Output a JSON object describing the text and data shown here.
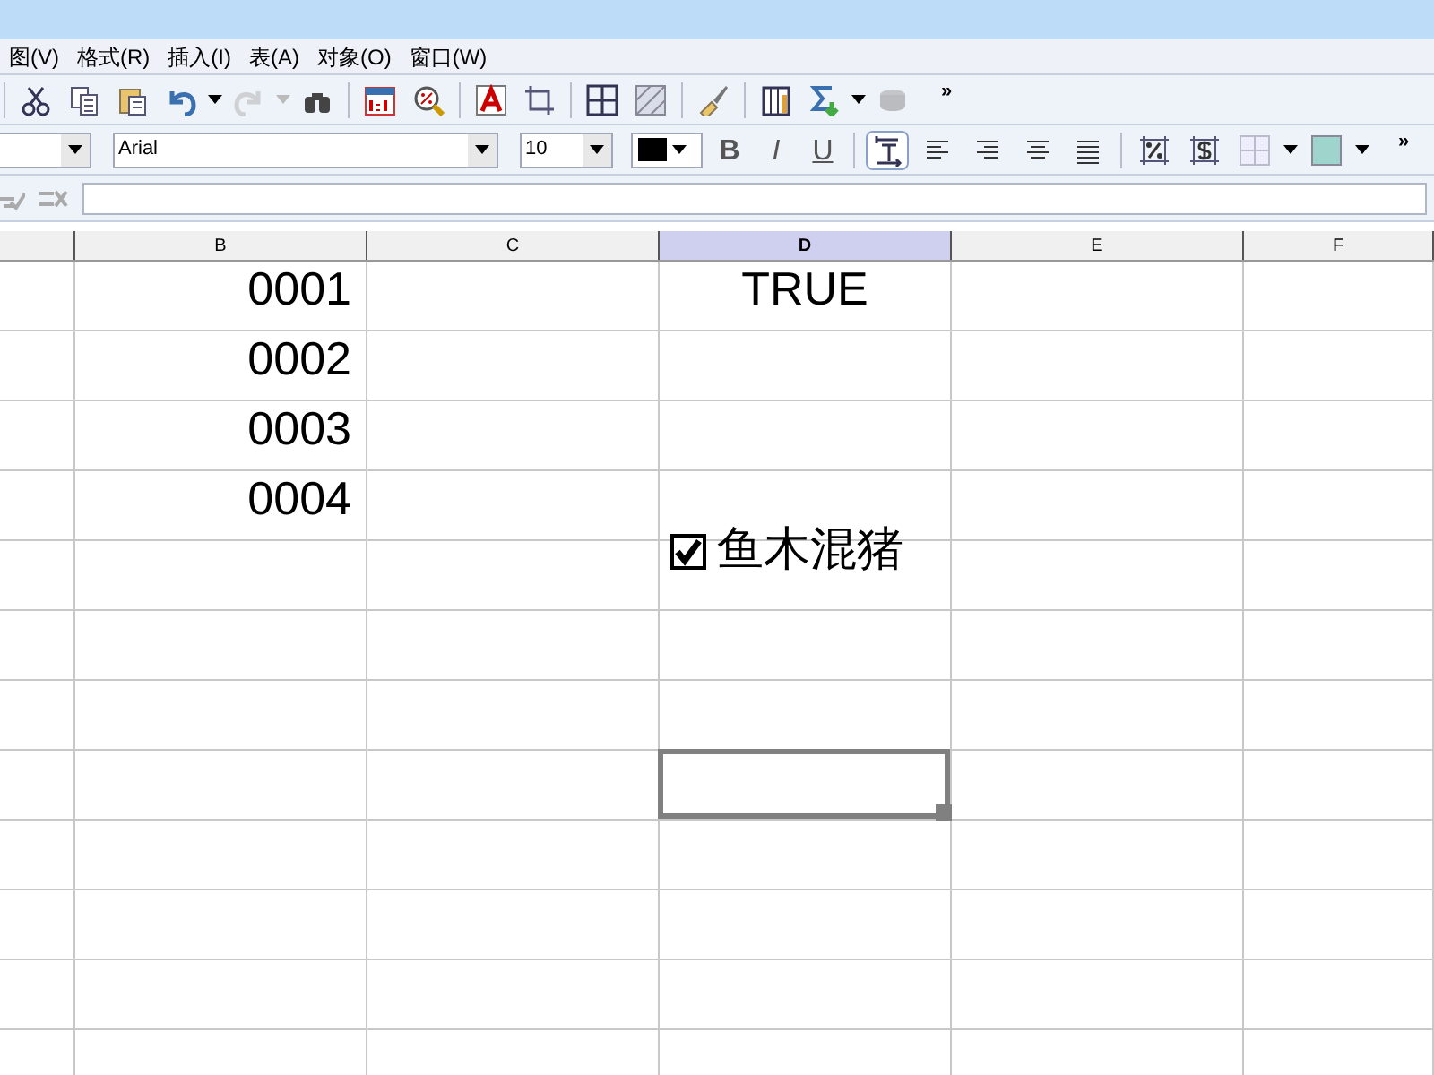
{
  "menu": [
    "图(V)",
    "格式(R)",
    "插入(I)",
    "表(A)",
    "对象(O)",
    "窗口(W)"
  ],
  "toolbar_1": [
    {
      "kind": "sep"
    },
    {
      "kind": "cut"
    },
    {
      "kind": "copy"
    },
    {
      "kind": "paste"
    },
    {
      "kind": "undo",
      "disabled": false
    },
    {
      "kind": "caret",
      "disabled": false
    },
    {
      "kind": "redo",
      "disabled": true
    },
    {
      "kind": "caret",
      "disabled": true
    },
    {
      "kind": "find"
    },
    {
      "kind": "sep"
    },
    {
      "kind": "ratio"
    },
    {
      "kind": "zoom"
    },
    {
      "kind": "sep"
    },
    {
      "kind": "fontcolor"
    },
    {
      "kind": "crop"
    },
    {
      "kind": "sep"
    },
    {
      "kind": "grid"
    },
    {
      "kind": "hatch"
    },
    {
      "kind": "sep"
    },
    {
      "kind": "brush"
    },
    {
      "kind": "sep"
    },
    {
      "kind": "columns"
    },
    {
      "kind": "sum"
    },
    {
      "kind": "caret",
      "disabled": false
    },
    {
      "kind": "database",
      "disabled": true
    }
  ],
  "toolbar_1_more": "»",
  "font": {
    "value": "Arial"
  },
  "size": {
    "value": "10"
  },
  "toolbar_2": [
    {
      "kind": "color"
    },
    {
      "kind": "bold",
      "label": "B"
    },
    {
      "kind": "italic",
      "label": "I"
    },
    {
      "kind": "underline",
      "label": "U"
    },
    {
      "kind": "sep"
    },
    {
      "kind": "textframe",
      "selected": true
    },
    {
      "kind": "alignleft"
    },
    {
      "kind": "alignright"
    },
    {
      "kind": "aligncenter"
    },
    {
      "kind": "justify"
    },
    {
      "kind": "sep"
    },
    {
      "kind": "percent"
    },
    {
      "kind": "currency"
    },
    {
      "kind": "borders"
    },
    {
      "kind": "caret",
      "disabled": false
    },
    {
      "kind": "fill"
    },
    {
      "kind": "caret",
      "disabled": false
    }
  ],
  "toolbar_2_more": "»",
  "columns": [
    {
      "selected": false
    },
    {
      "label": "B",
      "selected": false
    },
    {
      "label": "C",
      "selected": false
    },
    {
      "label": "D",
      "selected": true
    },
    {
      "label": "E",
      "selected": false
    },
    {
      "label": "F",
      "selected": false
    }
  ],
  "rows": [
    {
      "cells": {
        "B": {
          "text": "0001"
        },
        "D": {
          "text": "TRUE"
        }
      }
    },
    {
      "cells": {
        "B": {
          "text": "0002"
        }
      }
    },
    {
      "cells": {
        "B": {
          "text": "0003"
        }
      }
    },
    {
      "cells": {
        "B": {
          "text": "0004"
        }
      }
    },
    {},
    {},
    {},
    {
      "cells": {
        "D": {
          "selected": true
        }
      }
    },
    {},
    {},
    {},
    {}
  ],
  "checkbox": {
    "label": "鱼木混猪",
    "checked": true
  }
}
